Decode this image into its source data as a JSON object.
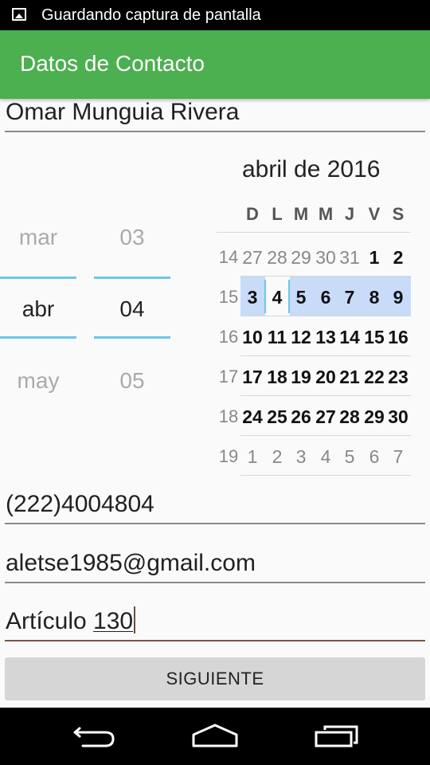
{
  "status_bar": {
    "notification_text": "Guardando captura de pantalla"
  },
  "app_bar": {
    "title": "Datos de Contacto",
    "color": "#4caf50"
  },
  "form": {
    "name": "Omar Munguia Rivera",
    "phone": "(222)4004804",
    "email": "aletse1985@gmail.com",
    "description_prefix": "Artículo ",
    "description_underlined": "130",
    "next_button": "SIGUIENTE"
  },
  "date_picker": {
    "month_spinner": {
      "prev": "mar",
      "selected": "abr",
      "next": "may"
    },
    "day_spinner": {
      "prev": "03",
      "selected": "04",
      "next": "05"
    },
    "calendar": {
      "title": "abril de 2016",
      "weekday_headers": [
        "D",
        "L",
        "M",
        "M",
        "J",
        "V",
        "S"
      ],
      "weeks": [
        {
          "number": "14",
          "days": [
            "27",
            "28",
            "29",
            "30",
            "31",
            "1",
            "2"
          ]
        },
        {
          "number": "15",
          "days": [
            "3",
            "4",
            "5",
            "6",
            "7",
            "8",
            "9"
          ]
        },
        {
          "number": "16",
          "days": [
            "10",
            "11",
            "12",
            "13",
            "14",
            "15",
            "16"
          ]
        },
        {
          "number": "17",
          "days": [
            "17",
            "18",
            "19",
            "20",
            "21",
            "22",
            "23"
          ]
        },
        {
          "number": "18",
          "days": [
            "24",
            "25",
            "26",
            "27",
            "28",
            "29",
            "30"
          ]
        },
        {
          "number": "19",
          "days": [
            "1",
            "2",
            "3",
            "4",
            "5",
            "6",
            "7"
          ]
        }
      ],
      "selected_date": "4",
      "selection_color": "#c8dbf8",
      "accent_color": "#6ec7e6"
    }
  },
  "nav_bar": {
    "icons": [
      "back-icon",
      "home-icon",
      "recents-icon"
    ]
  }
}
